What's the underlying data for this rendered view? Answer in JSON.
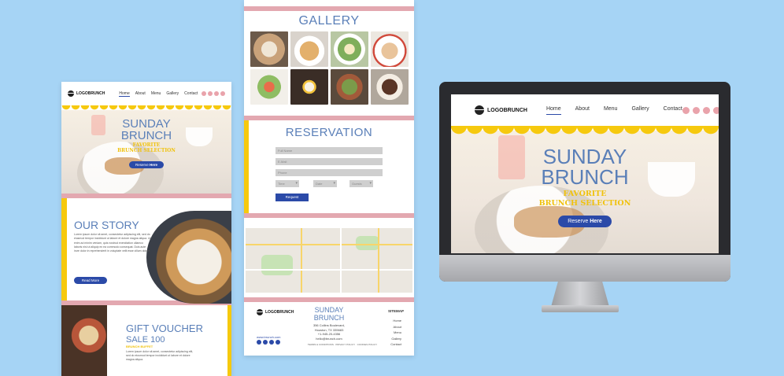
{
  "brand": "LOGOBRUNCH",
  "colors": {
    "background": "#a6d4f5",
    "accent_blue": "#2b4aa8",
    "title_blue": "#5a7fb8",
    "yellow": "#f6c90e",
    "pink": "#e3a8b0"
  },
  "nav": {
    "home": "Home",
    "about": "About",
    "menu": "Menu",
    "gallery": "Gallery",
    "contact": "Contact"
  },
  "social_icons": [
    "instagram-icon",
    "facebook-icon",
    "twitter-icon",
    "dribbble-icon"
  ],
  "hero": {
    "title_line1": "SUNDAY",
    "title_line2": "BRUNCH",
    "subtitle_line1": "FAVORITE",
    "subtitle_line2": "BRUNCH SELECTION",
    "cta_prefix": "Reserve ",
    "cta_bold": "Here"
  },
  "story": {
    "title": "OUR STORY",
    "text": "Lorem ipsum dolor sit amet, consectetur adipiscing elit, sed do eiusmod tempor incididunt ut labore et dolore magna aliqua. Ut enim ad minim veniam, quis nostrud exercitation ullamco laboris nisi ut aliquip ex ea commodo consequat. Duis aute irure dolor in reprehenderit in voluptate velit esse cillum dolore.",
    "cta": "Read More"
  },
  "gift": {
    "title": "GIFT VOUCHER",
    "sale": "SALE 100",
    "sub": "BRUNCH BUFFET",
    "text": "Lorem ipsum dolor sit amet, consectetur adipiscing elit, sed do eiusmod tempor incididunt ut labore et dolore magna aliqua."
  },
  "gallery": {
    "title": "GALLERY"
  },
  "reservation": {
    "title": "RESERVATION",
    "full_name": "Full Name",
    "email": "E-Mail",
    "phone": "Phone",
    "time": "Time",
    "date": "Date",
    "guests": "Guests",
    "submit": "Request"
  },
  "footer": {
    "title_line1": "SUNDAY",
    "title_line2": "BRUNCH",
    "address_line1": "356 Collins Boulevard,",
    "address_line2": "Houston, TX 335683",
    "phone": "+1-945-20-4356",
    "email": "hello@brunch.com",
    "url": "www.brunch.com",
    "terms": "TERMS & CONDITIONS",
    "privacy": "PRIVACY POLICY",
    "cookies": "COOKIES POLICY",
    "sitemap_title": "SITEMAP",
    "sitemap": [
      "Home",
      "About",
      "Menu",
      "Gallery",
      "Contact"
    ]
  }
}
